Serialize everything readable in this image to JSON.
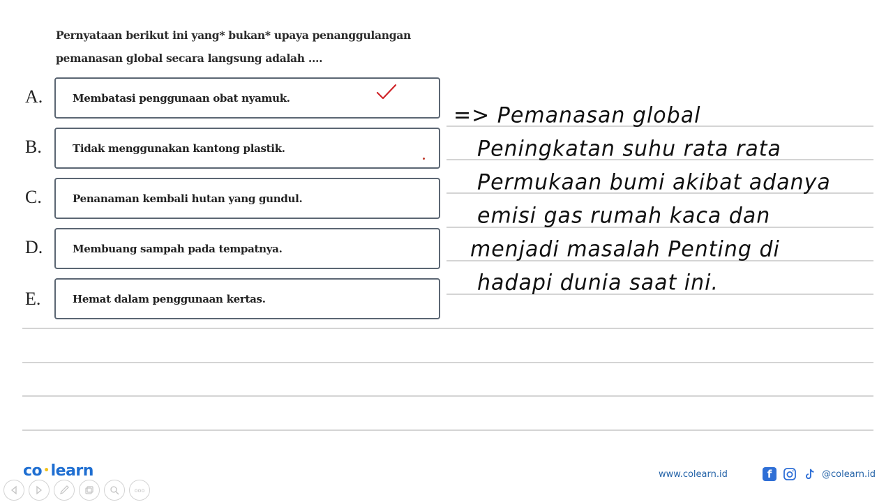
{
  "question": {
    "line1": "Pernyataan berikut ini yang* bukan* upaya penanggulangan",
    "line2": "pemanasan global secara langsung adalah ...."
  },
  "options": [
    {
      "letter": "A.",
      "text": "Membatasi penggunaan obat nyamuk.",
      "marked_correct": true
    },
    {
      "letter": "B.",
      "text": "Tidak menggunakan kantong plastik.",
      "marked_correct": false
    },
    {
      "letter": "C.",
      "text": "Penanaman kembali hutan yang gundul.",
      "marked_correct": false
    },
    {
      "letter": "D.",
      "text": "Membuang sampah pada tempatnya.",
      "marked_correct": false
    },
    {
      "letter": "E.",
      "text": "Hemat dalam penggunaan kertas.",
      "marked_correct": false
    }
  ],
  "handwritten_answer": [
    "=> Pemanasan  global",
    "Peningkatan  suhu  rata  rata",
    "Permukaan  bumi  akibat  adanya",
    "emisi  gas  rumah  kaca  dan",
    "menjadi  masalah  Penting  di",
    "hadapi  dunia  saat  ini."
  ],
  "footer": {
    "logo_left": "co",
    "logo_right": "learn",
    "website": "www.colearn.id",
    "social_handle": "@colearn.id",
    "toolbar_icons": [
      "prev-icon",
      "next-icon",
      "pen-icon",
      "copy-icon",
      "zoom-icon",
      "more-icon"
    ],
    "more_label": "ooo"
  },
  "colors": {
    "accent": "#1e6ed1",
    "check": "#d0262b",
    "box_border": "#5b6673"
  }
}
